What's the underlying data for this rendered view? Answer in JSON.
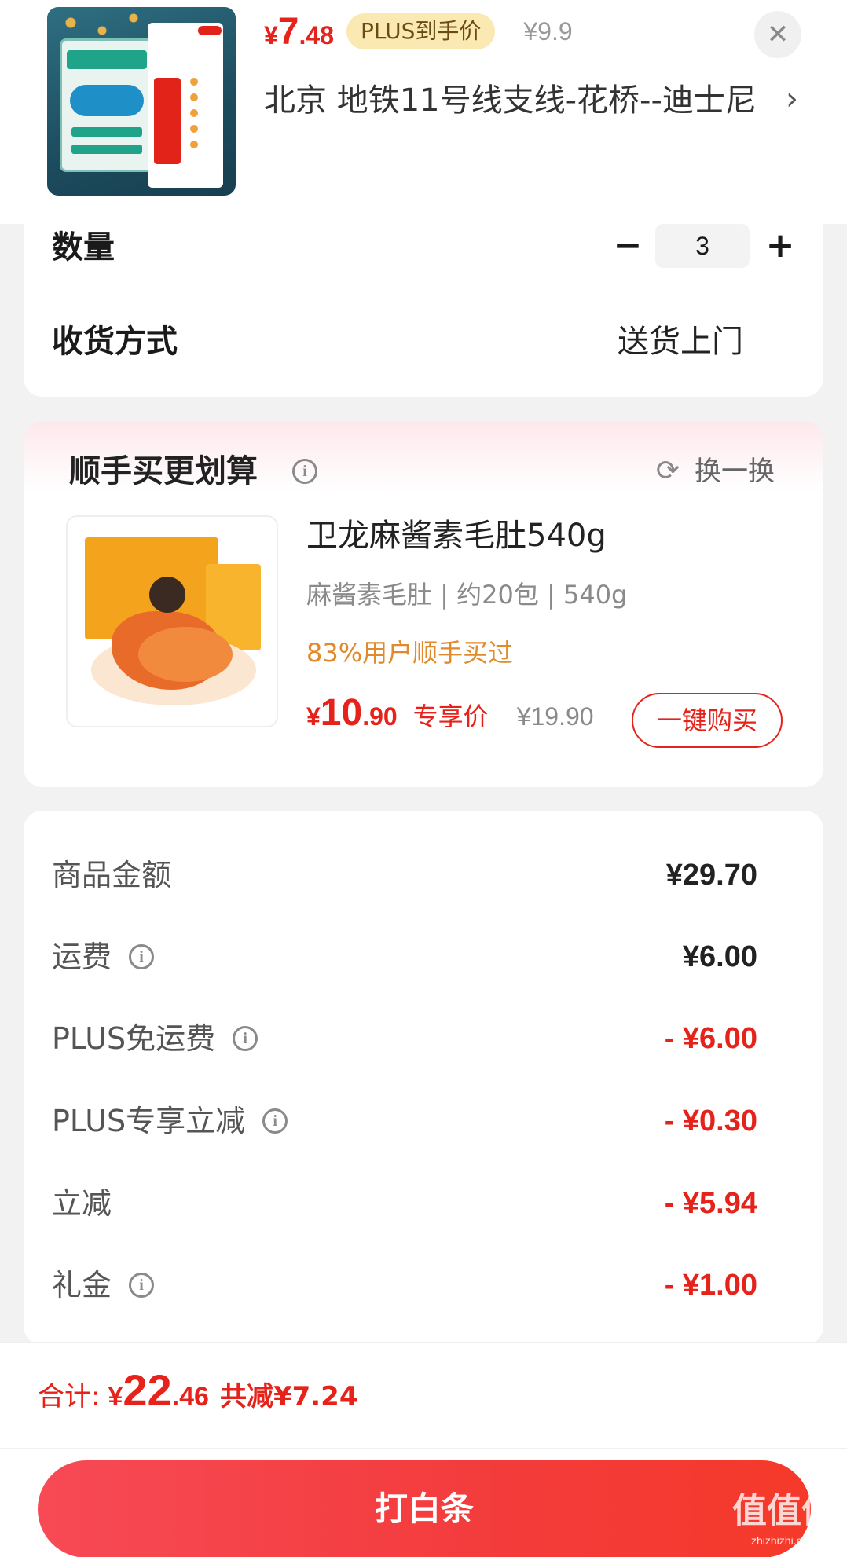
{
  "header": {
    "price_yen": "¥",
    "price_int": "7",
    "price_dec": ".48",
    "plus_tag": "PLUS到手价",
    "original_price": "¥9.9",
    "close_icon": "close-icon",
    "address": "北京  地铁11号线支线-花桥--迪士尼",
    "chevron_icon": "chevron-right-icon"
  },
  "order": {
    "quantity_label": "数量",
    "quantity_value": "3",
    "minus_icon": "minus-icon",
    "plus_icon": "plus-icon",
    "shipping_label": "收货方式",
    "shipping_value": "送货上门"
  },
  "recommend": {
    "title": "顺手买更划算",
    "refresh_label": "换一换",
    "product_name": "卫龙麻酱素毛肚540g",
    "product_spec": "麻酱素毛肚 | 约20包 | 540g",
    "product_hint": "83%用户顺手买过",
    "price_yen": "¥",
    "price_int": "10",
    "price_dec": ".90",
    "exclusive_label": "专享价",
    "original_price": "¥19.90",
    "buy_button": "一键购买"
  },
  "cost_breakdown": [
    {
      "label": "商品金额",
      "value": "¥29.70",
      "info": false,
      "highlight": false
    },
    {
      "label": "运费",
      "value": "¥6.00",
      "info": true,
      "highlight": false
    },
    {
      "label": "PLUS免运费",
      "value": "- ¥6.00",
      "info": true,
      "highlight": true
    },
    {
      "label": "PLUS专享立减",
      "value": "- ¥0.30",
      "info": true,
      "highlight": true
    },
    {
      "label": "立减",
      "value": "- ¥5.94",
      "info": false,
      "highlight": true
    },
    {
      "label": "礼金",
      "value": "- ¥1.00",
      "info": true,
      "highlight": true
    }
  ],
  "footer": {
    "total_label": "合计:",
    "total_yen": "¥",
    "total_int": "22",
    "total_dec": ".46",
    "total_saved": "共减¥7.24",
    "pay_button": "打白条"
  },
  "watermark": {
    "main": "值值值",
    "sub": "zhizhizhi.com"
  },
  "colors": {
    "accent_red": "#e5231b",
    "plus_tag_bg": "#fbe9b3",
    "hint_orange": "#e08a2b"
  }
}
